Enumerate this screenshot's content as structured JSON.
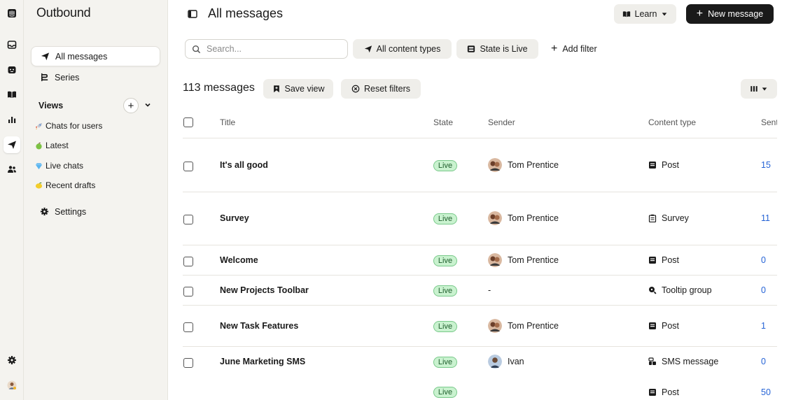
{
  "sidebar": {
    "title": "Outbound",
    "nav": [
      {
        "label": "All messages",
        "icon": "paper-plane-icon"
      },
      {
        "label": "Series",
        "icon": "series-icon"
      }
    ],
    "views_label": "Views",
    "views": [
      {
        "label": "Chats for users",
        "icon": "rocket-emoji"
      },
      {
        "label": "Latest",
        "icon": "apple-emoji"
      },
      {
        "label": "Live chats",
        "icon": "diamond-emoji"
      },
      {
        "label": "Recent drafts",
        "icon": "lemon-emoji"
      }
    ],
    "settings_label": "Settings"
  },
  "header": {
    "title": "All messages",
    "learn_label": "Learn",
    "new_message_label": "New message"
  },
  "filters": {
    "search_placeholder": "Search...",
    "content_types_label": "All content types",
    "state_label": "State is Live",
    "add_filter_label": "Add filter"
  },
  "summary": {
    "count_label": "113 messages",
    "save_view_label": "Save view",
    "reset_filters_label": "Reset filters"
  },
  "table": {
    "columns": {
      "title": "Title",
      "state": "State",
      "sender": "Sender",
      "content_type": "Content type",
      "sent": "Sent"
    },
    "rows": [
      {
        "title": "It's all good",
        "state": "Live",
        "sender": "Tom Prentice",
        "content_type": "Post",
        "sent": "15"
      },
      {
        "title": "Survey",
        "state": "Live",
        "sender": "Tom Prentice",
        "content_type": "Survey",
        "sent": "11"
      },
      {
        "title": "Welcome",
        "state": "Live",
        "sender": "Tom Prentice",
        "content_type": "Post",
        "sent": "0"
      },
      {
        "title": "New Projects Toolbar",
        "state": "Live",
        "sender": "-",
        "content_type": "Tooltip group",
        "sent": "0"
      },
      {
        "title": "New Task Features",
        "state": "Live",
        "sender": "Tom Prentice",
        "content_type": "Post",
        "sent": "1"
      },
      {
        "title": "June Marketing SMS",
        "state": "Live",
        "sender": "Ivan",
        "content_type": "SMS message",
        "sent": "0"
      },
      {
        "title": "",
        "state": "Live",
        "sender": "",
        "content_type": "Post",
        "sent": "50"
      }
    ]
  },
  "colors": {
    "live_badge_bg": "#c9f2cf",
    "live_badge_border": "#79c98a",
    "link_blue": "#2563d6",
    "primary_button": "#1a1a1a"
  }
}
